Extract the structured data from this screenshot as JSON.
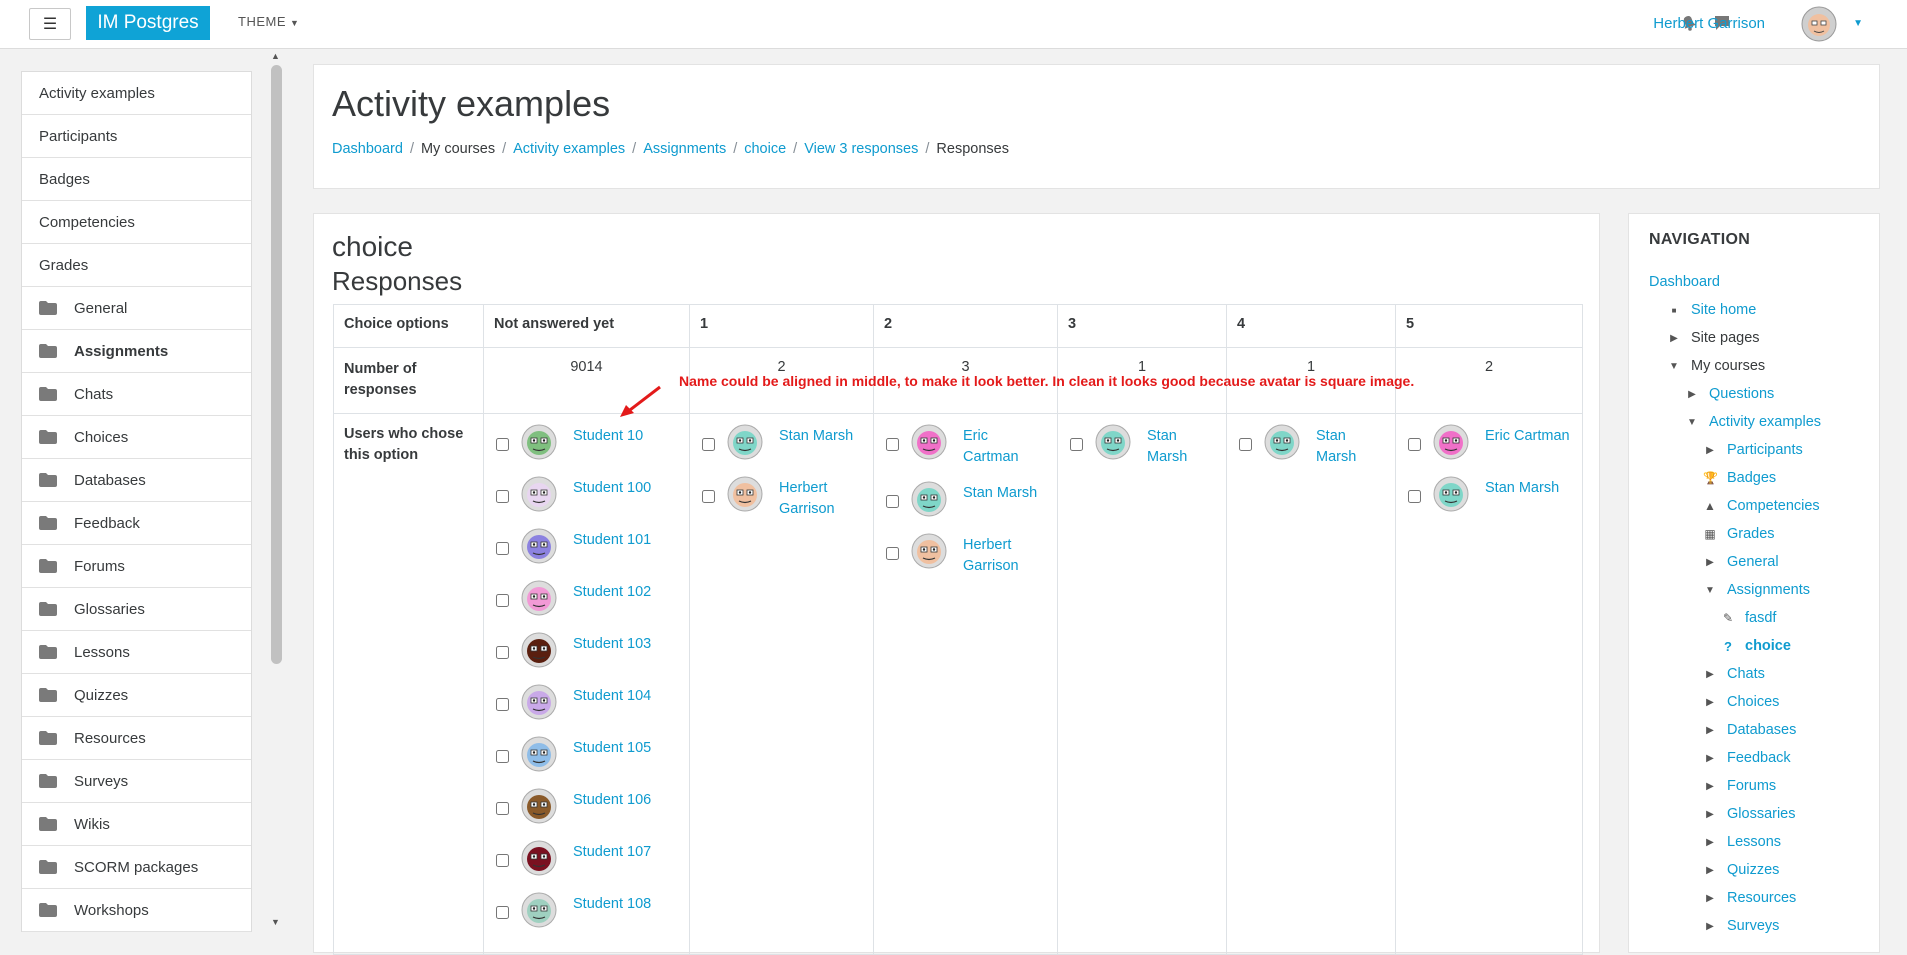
{
  "navbar": {
    "menu_toggle": "☰",
    "brand": "IM Postgres",
    "theme_label": "THEME",
    "user_name": "Herbert Garrison"
  },
  "drawer": {
    "items": [
      {
        "label": "Activity examples",
        "folder": false,
        "bold": false
      },
      {
        "label": "Participants",
        "folder": false,
        "bold": false
      },
      {
        "label": "Badges",
        "folder": false,
        "bold": false
      },
      {
        "label": "Competencies",
        "folder": false,
        "bold": false
      },
      {
        "label": "Grades",
        "folder": false,
        "bold": false
      },
      {
        "label": "General",
        "folder": true,
        "bold": false
      },
      {
        "label": "Assignments",
        "folder": true,
        "bold": true
      },
      {
        "label": "Chats",
        "folder": true,
        "bold": false
      },
      {
        "label": "Choices",
        "folder": true,
        "bold": false
      },
      {
        "label": "Databases",
        "folder": true,
        "bold": false
      },
      {
        "label": "Feedback",
        "folder": true,
        "bold": false
      },
      {
        "label": "Forums",
        "folder": true,
        "bold": false
      },
      {
        "label": "Glossaries",
        "folder": true,
        "bold": false
      },
      {
        "label": "Lessons",
        "folder": true,
        "bold": false
      },
      {
        "label": "Quizzes",
        "folder": true,
        "bold": false
      },
      {
        "label": "Resources",
        "folder": true,
        "bold": false
      },
      {
        "label": "Surveys",
        "folder": true,
        "bold": false
      },
      {
        "label": "Wikis",
        "folder": true,
        "bold": false
      },
      {
        "label": "SCORM packages",
        "folder": true,
        "bold": false
      },
      {
        "label": "Workshops",
        "folder": true,
        "bold": false
      }
    ]
  },
  "header": {
    "title": "Activity examples",
    "breadcrumb": [
      {
        "label": "Dashboard",
        "link": true
      },
      {
        "label": "My courses",
        "link": false
      },
      {
        "label": "Activity examples",
        "link": true
      },
      {
        "label": "Assignments",
        "link": true
      },
      {
        "label": "choice",
        "link": true
      },
      {
        "label": "View 3 responses",
        "link": true
      },
      {
        "label": "Responses",
        "link": false
      }
    ]
  },
  "main": {
    "activity_name": "choice",
    "section_title": "Responses",
    "table": {
      "corner_header": "Choice options",
      "count_label": "Number of responses",
      "users_label": "Users who chose this option",
      "columns": [
        {
          "header": "Not answered yet",
          "count": "9014",
          "users": [
            "Student 10",
            "Student 100",
            "Student 101",
            "Student 102",
            "Student 103",
            "Student 104",
            "Student 105",
            "Student 106",
            "Student 107",
            "Student 108"
          ]
        },
        {
          "header": "1",
          "count": "2",
          "users": [
            "Stan Marsh",
            "Herbert Garrison"
          ]
        },
        {
          "header": "2",
          "count": "3",
          "users": [
            "Eric Cartman",
            "Stan Marsh",
            "Herbert Garrison"
          ]
        },
        {
          "header": "3",
          "count": "1",
          "users": [
            "Stan Marsh"
          ]
        },
        {
          "header": "4",
          "count": "1",
          "users": [
            "Stan Marsh"
          ]
        },
        {
          "header": "5",
          "count": "2",
          "users": [
            "Eric Cartman",
            "Stan Marsh"
          ]
        }
      ]
    },
    "annotation": "Name could be aligned in middle, to make it look better. In clean it looks good because avatar is square image."
  },
  "navigation": {
    "title": "NAVIGATION",
    "items": [
      {
        "label": "Dashboard",
        "indent": 0,
        "icon": "",
        "style": "link"
      },
      {
        "label": "Site home",
        "indent": 1,
        "icon": "square",
        "style": "link"
      },
      {
        "label": "Site pages",
        "indent": 1,
        "icon": "caret-right",
        "style": "plain"
      },
      {
        "label": "My courses",
        "indent": 1,
        "icon": "caret-down",
        "style": "plain"
      },
      {
        "label": "Questions",
        "indent": 2,
        "icon": "caret-right",
        "style": "link"
      },
      {
        "label": "Activity examples",
        "indent": 2,
        "icon": "caret-down",
        "style": "link"
      },
      {
        "label": "Participants",
        "indent": 3,
        "icon": "caret-right",
        "style": "link"
      },
      {
        "label": "Badges",
        "indent": 3,
        "icon": "trophy",
        "style": "link"
      },
      {
        "label": "Competencies",
        "indent": 3,
        "icon": "pyramid",
        "style": "link"
      },
      {
        "label": "Grades",
        "indent": 3,
        "icon": "table",
        "style": "link"
      },
      {
        "label": "General",
        "indent": 3,
        "icon": "caret-right",
        "style": "link"
      },
      {
        "label": "Assignments",
        "indent": 3,
        "icon": "caret-down",
        "style": "link"
      },
      {
        "label": "fasdf",
        "indent": 4,
        "icon": "assign",
        "style": "link"
      },
      {
        "label": "choice",
        "indent": 4,
        "icon": "question",
        "style": "strong"
      },
      {
        "label": "Chats",
        "indent": 3,
        "icon": "caret-right",
        "style": "link"
      },
      {
        "label": "Choices",
        "indent": 3,
        "icon": "caret-right",
        "style": "link"
      },
      {
        "label": "Databases",
        "indent": 3,
        "icon": "caret-right",
        "style": "link"
      },
      {
        "label": "Feedback",
        "indent": 3,
        "icon": "caret-right",
        "style": "link"
      },
      {
        "label": "Forums",
        "indent": 3,
        "icon": "caret-right",
        "style": "link"
      },
      {
        "label": "Glossaries",
        "indent": 3,
        "icon": "caret-right",
        "style": "link"
      },
      {
        "label": "Lessons",
        "indent": 3,
        "icon": "caret-right",
        "style": "link"
      },
      {
        "label": "Quizzes",
        "indent": 3,
        "icon": "caret-right",
        "style": "link"
      },
      {
        "label": "Resources",
        "indent": 3,
        "icon": "caret-right",
        "style": "link"
      },
      {
        "label": "Surveys",
        "indent": 3,
        "icon": "caret-right",
        "style": "link"
      }
    ]
  },
  "colors": {
    "brand": "#0fa3d6",
    "link": "#0f9bcf",
    "annotation": "#e31a1a"
  },
  "avatar_colors": {
    "Student 10": "#7fbf7f",
    "Student 100": "#e8d6f0",
    "Student 101": "#8c82e0",
    "Student 102": "#f29ad6",
    "Student 103": "#5a1f0f",
    "Student 104": "#c9a9e8",
    "Student 105": "#8fbde8",
    "Student 106": "#8a5a2a",
    "Student 107": "#7a1020",
    "Student 108": "#9fd0c0",
    "Stan Marsh": "#7fd6c8",
    "Herbert Garrison": "#f0c0a0",
    "Eric Cartman": "#f070c8"
  }
}
